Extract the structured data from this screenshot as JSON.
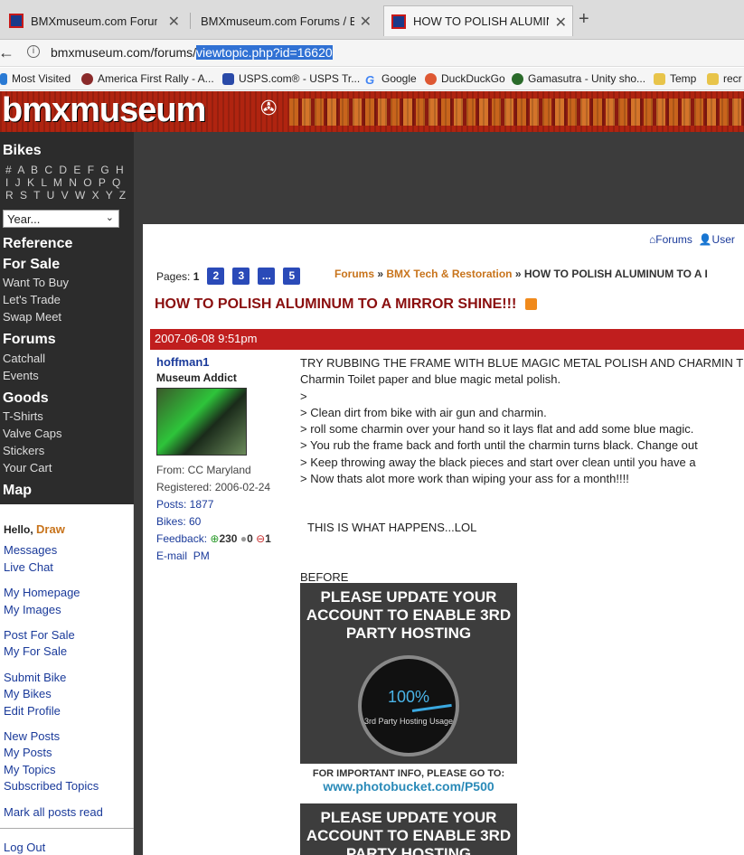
{
  "browser": {
    "tabs": [
      {
        "title": "BMXmuseum.com Forums /"
      },
      {
        "title": "BMXmuseum.com Forums / BM"
      },
      {
        "title": "HOW TO POLISH ALUMINU"
      }
    ],
    "url_prefix": "bmxmuseum.com/forums/",
    "url_selected": "viewtopic.php?id=16620",
    "bookmarks": [
      "Most Visited",
      "America First Rally - A...",
      "USPS.com® - USPS Tr...",
      "Google",
      "DuckDuckGo",
      "Gamasutra - Unity sho...",
      "Temp",
      "recr"
    ]
  },
  "site": {
    "logo": "bmxmuseum"
  },
  "sidebar": {
    "bikes_title": "Bikes",
    "alpha_row1": "# A B C D E F G H",
    "alpha_row2": "I J K L M N O P Q",
    "alpha_row3": "R S T U V W X Y Z",
    "year_select": "Year...",
    "reference": "Reference",
    "forsale": "For Sale",
    "want": "Want To Buy",
    "trade": "Let's Trade",
    "swap": "Swap Meet",
    "forums": "Forums",
    "catchall": "Catchall",
    "events": "Events",
    "goods": "Goods",
    "tshirts": "T-Shirts",
    "valve": "Valve Caps",
    "stickers": "Stickers",
    "cart": "Your Cart",
    "map": "Map"
  },
  "user_menu": {
    "hello": "Hello,",
    "user": "Draw",
    "items": [
      "Messages",
      "Live Chat",
      "My Homepage",
      "My Images",
      "Post For Sale",
      "My For Sale",
      "Submit Bike",
      "My Bikes",
      "Edit Profile",
      "New Posts",
      "My Posts",
      "My Topics",
      "Subscribed Topics",
      "Mark all posts read",
      "Log Out"
    ]
  },
  "forum": {
    "toplink_forums": "Forums",
    "toplink_users": "User",
    "pages_label": "Pages:",
    "current_page": "1",
    "page_links": [
      "2",
      "3",
      "...",
      "5"
    ],
    "crumb_forums": "Forums",
    "crumb_sep": "»",
    "crumb_section": "BMX Tech & Restoration",
    "crumb_topic": "HOW TO POLISH ALUMINUM TO A I",
    "topic_title": "HOW TO POLISH ALUMINUM TO A MIRROR SHINE!!!",
    "post_date": "2007-06-08 9:51pm"
  },
  "author": {
    "name": "hoffman1",
    "rank": "Museum Addict",
    "from": "From: CC Maryland",
    "registered": "Registered: 2006-02-24",
    "posts": "Posts: 1877",
    "bikes": "Bikes: 60",
    "feedback_label": "Feedback:",
    "fb_pos": "230",
    "fb_neu": "0",
    "fb_neg": "1",
    "email": "E-mail",
    "pm": "PM"
  },
  "post": {
    "lines": [
      "TRY RUBBING THE FRAME WITH BLUE MAGIC METAL POLISH AND CHARMIN TIOL",
      "Charmin Toilet paper and blue magic metal polish.",
      ">",
      ">   Clean dirt from bike with air gun and charmin.",
      ">   roll some charmin over your hand so it lays flat and add some blue magic.",
      ">   You rub the frame back and forth until the charmin turns black. Change out",
      ">   Keep throwing away the black pieces and start over clean until you have a",
      ">   Now thats alot more work than wiping your ass for a month!!!!"
    ],
    "happens": "THIS IS WHAT HAPPENS...LOL",
    "before": "BEFORE"
  },
  "photobucket": {
    "headline": "PLEASE UPDATE YOUR ACCOUNT TO ENABLE 3RD PARTY HOSTING",
    "pct": "100%",
    "gauge_label": "3rd Party Hosting Usage",
    "info": "FOR IMPORTANT INFO, PLEASE GO TO:",
    "url": "www.photobucket.com/P500"
  }
}
